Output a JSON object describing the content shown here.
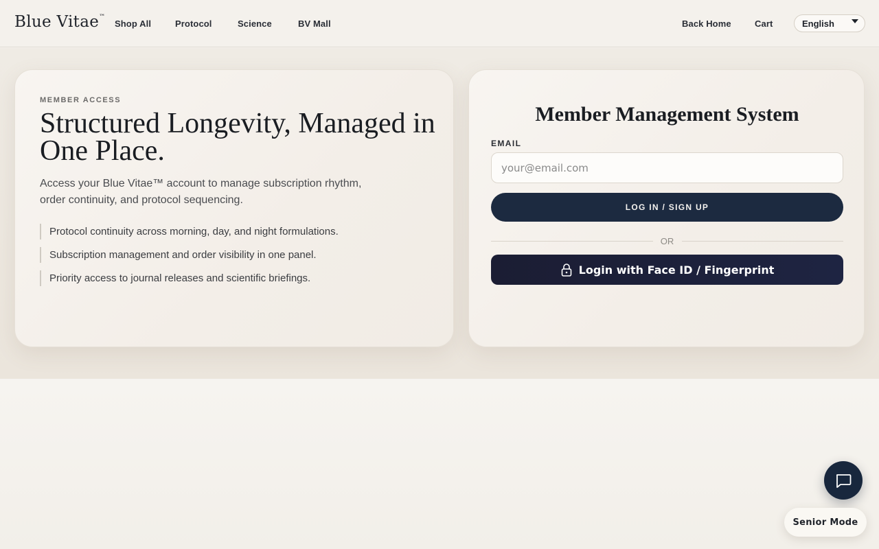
{
  "header": {
    "brand": "Blue Vitae",
    "brand_mark": "™",
    "nav": [
      {
        "label": "Shop All"
      },
      {
        "label": "Protocol"
      },
      {
        "label": "Science"
      },
      {
        "label": "BV Mall"
      }
    ],
    "back_home": "Back Home",
    "cart": "Cart",
    "language": "English"
  },
  "intro": {
    "eyebrow": "MEMBER ACCESS",
    "title": "Structured Longevity, Managed in One Place.",
    "description": "Access your Blue Vitae™ account to manage subscription rhythm, order continuity, and protocol sequencing.",
    "benefits": [
      "Protocol continuity across morning, day, and night formulations.",
      "Subscription management and order visibility in one panel.",
      "Priority access to journal releases and scientific briefings."
    ]
  },
  "login": {
    "title": "Member Management System",
    "email_label": "EMAIL",
    "email_placeholder": "your@email.com",
    "email_value": "",
    "submit_label": "LOG IN / SIGN UP",
    "divider": "OR",
    "biometric_label": "Login with Face ID / Fingerprint"
  },
  "floating": {
    "chat_icon": "chat-bubble-icon",
    "senior_mode": "Senior Mode"
  },
  "colors": {
    "primary_navy": "#1c2a40",
    "biometric_navy": "#1b1d33",
    "background": "#f5f2ed"
  }
}
